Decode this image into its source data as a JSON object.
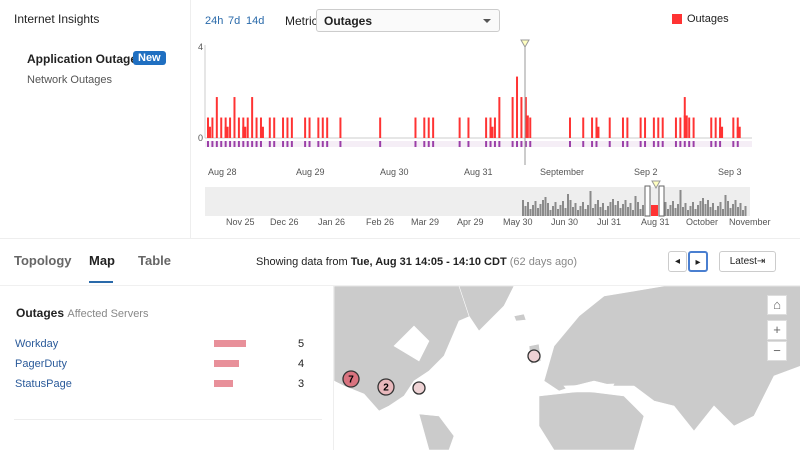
{
  "app": {
    "title": "Internet Insights"
  },
  "sidebar": {
    "items": [
      {
        "label": "Application Outages",
        "badge": "New",
        "active": true
      },
      {
        "label": "Network Outages"
      }
    ]
  },
  "toolbar": {
    "ranges": [
      "24h",
      "7d",
      "14d"
    ],
    "metric_label": "Metric",
    "metric_value": "Outages",
    "legend": "Outages"
  },
  "chart_data": {
    "type": "bar",
    "y_ticks": [
      "4",
      "0"
    ],
    "ylim": [
      0,
      4
    ],
    "x_ticks": [
      "Aug 28",
      "Aug 29",
      "Aug 30",
      "Aug 31",
      "September",
      "Sep 2",
      "Sep 3"
    ],
    "series": [
      {
        "name": "Outages",
        "color": "#ff3333",
        "values": [
          1,
          1,
          2,
          1,
          1,
          1,
          2,
          1,
          1,
          1,
          2,
          1,
          1,
          0,
          1,
          1,
          0,
          1,
          1,
          1,
          0,
          0,
          1,
          1,
          0,
          1,
          1,
          1,
          0,
          0,
          1,
          0,
          0,
          0,
          0,
          0,
          0,
          0,
          0,
          1,
          0,
          0,
          0,
          0,
          0,
          0,
          0,
          1,
          0,
          1,
          1,
          1,
          0,
          0,
          0,
          0,
          0,
          1,
          0,
          1,
          0,
          0,
          0,
          1,
          1,
          1,
          2,
          0,
          0,
          2,
          3,
          2,
          2,
          1,
          0,
          0,
          0,
          0,
          0,
          0,
          0,
          0,
          1,
          0,
          0,
          1,
          0,
          1,
          1,
          0,
          0,
          1,
          0,
          0,
          1,
          1,
          0,
          0,
          1,
          1,
          0,
          1,
          1,
          1,
          0,
          0,
          1,
          1,
          2,
          1,
          1,
          0,
          0,
          0,
          1,
          1,
          1,
          0,
          0,
          1,
          1,
          0,
          0
        ]
      }
    ],
    "selected": "Aug 31 14:05",
    "navigator_ticks": [
      "Nov 25",
      "Dec 26",
      "Jan 26",
      "Feb 26",
      "Mar 29",
      "Apr 29",
      "May 30",
      "Jun 30",
      "Jul 31",
      "Aug 31",
      "October",
      "November"
    ]
  },
  "tabs": [
    {
      "label": "Topology"
    },
    {
      "label": "Map",
      "active": true
    },
    {
      "label": "Table"
    }
  ],
  "status": {
    "prefix": "Showing data from",
    "range": "Tue, Aug 31 14:05 - 14:10 CDT",
    "ago": "(62 days ago)"
  },
  "controls": {
    "prev": "◂",
    "next": "▸",
    "latest": "Latest⇥"
  },
  "outages": {
    "title": "Outages",
    "subtitle": "Affected Servers",
    "rows": [
      {
        "name": "Workday",
        "count": "5"
      },
      {
        "name": "PagerDuty",
        "count": "4"
      },
      {
        "name": "StatusPage",
        "count": "3"
      }
    ]
  },
  "map": {
    "clusters": [
      {
        "label": "7"
      },
      {
        "label": "2"
      },
      {
        "label": ""
      },
      {
        "label": ""
      }
    ],
    "controls": {
      "home": "⌂",
      "zoom_in": "+",
      "zoom_out": "−"
    }
  }
}
